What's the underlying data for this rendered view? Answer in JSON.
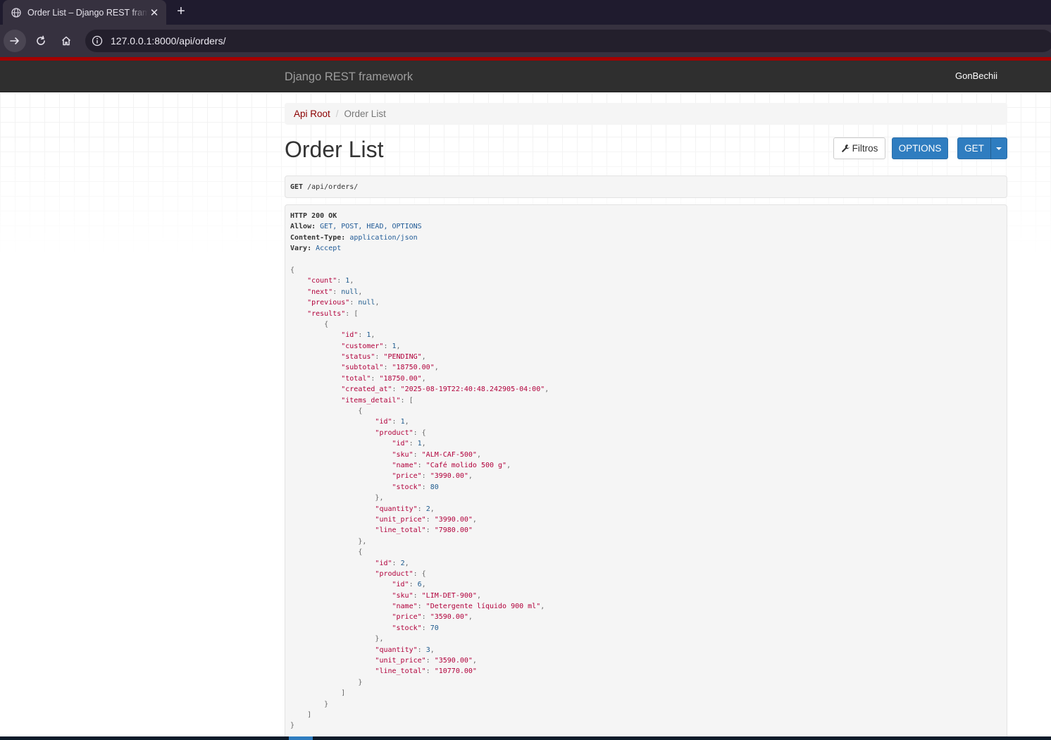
{
  "browser": {
    "tab_title": "Order List – Django REST framework",
    "url": "127.0.0.1:8000/api/orders/",
    "accent_color": "#a40000"
  },
  "navbar": {
    "brand": "Django REST framework",
    "user": "GonBechii"
  },
  "breadcrumb": {
    "root": "Api Root",
    "separator": "/",
    "current": "Order List"
  },
  "page": {
    "title": "Order List",
    "filters_label": "Filtros",
    "options_label": "OPTIONS",
    "get_label": "GET"
  },
  "request": {
    "method": "GET",
    "path": "/api/orders/"
  },
  "response": {
    "status": "HTTP 200 OK",
    "headers": [
      {
        "key": "Allow:",
        "value": "GET, POST, HEAD, OPTIONS"
      },
      {
        "key": "Content-Type:",
        "value": "application/json"
      },
      {
        "key": "Vary:",
        "value": "Accept"
      }
    ],
    "body": {
      "count": 1,
      "next": null,
      "previous": null,
      "results": [
        {
          "id": 1,
          "customer": 1,
          "status": "PENDING",
          "subtotal": "18750.00",
          "total": "18750.00",
          "created_at": "2025-08-19T22:40:48.242905-04:00",
          "items_detail": [
            {
              "id": 1,
              "product": {
                "id": 1,
                "sku": "ALM-CAF-500",
                "name": "Café molido 500 g",
                "price": "3990.00",
                "stock": 80
              },
              "quantity": 2,
              "unit_price": "3990.00",
              "line_total": "7980.00"
            },
            {
              "id": 2,
              "product": {
                "id": 6,
                "sku": "LIM-DET-900",
                "name": "Detergente líquido 900 ml",
                "price": "3590.00",
                "stock": 70
              },
              "quantity": 3,
              "unit_price": "3590.00",
              "line_total": "10770.00"
            }
          ]
        }
      ]
    }
  },
  "colors": {
    "navbar_bg": "#2f2f2f",
    "primary_button": "#2f7dc0",
    "link": "#8b0000",
    "json_string": "#b1003b",
    "json_literal": "#1e5a8d"
  },
  "icons": [
    "globe-icon",
    "close-icon",
    "plus-icon",
    "forward-arrow-icon",
    "reload-icon",
    "home-icon",
    "info-icon",
    "wrench-icon",
    "caret-down-icon"
  ]
}
